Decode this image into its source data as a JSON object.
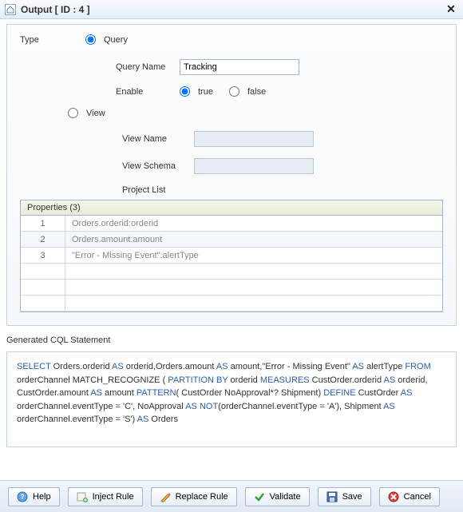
{
  "window": {
    "title": "Output [ ID : 4 ]"
  },
  "form": {
    "type_label": "Type",
    "query_label": "Query",
    "view_label": "View",
    "query_name_label": "Query Name",
    "query_name_value": "Tracking",
    "enable_label": "Enable",
    "enable_true": "true",
    "enable_false": "false",
    "view_name_label": "View Name",
    "view_schema_label": "View Schema",
    "project_list_label": "Project List"
  },
  "table": {
    "header": "Properties (3)",
    "rows": [
      {
        "idx": "1",
        "value": "Orders.orderid:orderid"
      },
      {
        "idx": "2",
        "value": "Orders.amount:amount"
      },
      {
        "idx": "3",
        "value": "\"Error - Missing Event\":alertType"
      }
    ]
  },
  "cql": {
    "label": "Generated CQL Statement",
    "tokens": [
      {
        "t": "SELECT",
        "k": true
      },
      {
        "t": " Orders.orderid "
      },
      {
        "t": "AS",
        "k": true
      },
      {
        "t": " orderid,Orders.amount "
      },
      {
        "t": "AS",
        "k": true
      },
      {
        "t": " amount,\"Error - Missing Event\" "
      },
      {
        "t": "AS",
        "k": true
      },
      {
        "t": " alertType "
      },
      {
        "t": "FROM",
        "k": true
      },
      {
        "t": " orderChannel  MATCH_RECOGNIZE ( "
      },
      {
        "t": "PARTITION BY",
        "k": true
      },
      {
        "t": " orderid "
      },
      {
        "t": "MEASURES",
        "k": true
      },
      {
        "t": " CustOrder.orderid "
      },
      {
        "t": "AS",
        "k": true
      },
      {
        "t": " orderid, CustOrder.amount "
      },
      {
        "t": "AS",
        "k": true
      },
      {
        "t": " amount "
      },
      {
        "t": "PATTERN",
        "k": true
      },
      {
        "t": "( CustOrder NoApproval*? Shipment) "
      },
      {
        "t": "DEFINE",
        "k": true
      },
      {
        "t": " CustOrder "
      },
      {
        "t": "AS",
        "k": true
      },
      {
        "t": " orderChannel.eventType = 'C', NoApproval "
      },
      {
        "t": "AS",
        "k": true
      },
      {
        "t": " "
      },
      {
        "t": "NOT",
        "k": true
      },
      {
        "t": "(orderChannel.eventType = 'A'), Shipment "
      },
      {
        "t": "AS",
        "k": true
      },
      {
        "t": " orderChannel.eventType = 'S') "
      },
      {
        "t": "AS",
        "k": true
      },
      {
        "t": " Orders"
      }
    ]
  },
  "buttons": {
    "help": "Help",
    "inject": "Inject Rule",
    "replace": "Replace Rule",
    "validate": "Validate",
    "save": "Save",
    "cancel": "Cancel"
  }
}
